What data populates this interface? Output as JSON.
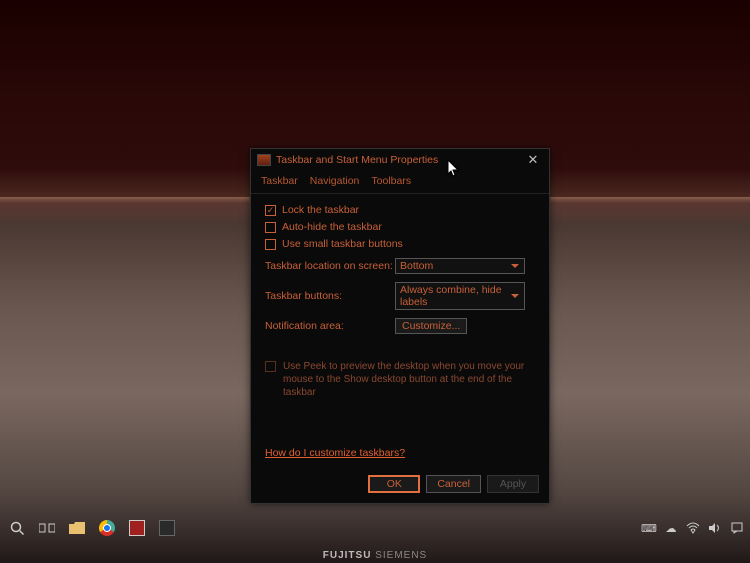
{
  "dialog": {
    "title": "Taskbar and Start Menu Properties",
    "tabs": [
      "Taskbar",
      "Navigation",
      "Toolbars"
    ],
    "checkboxes": {
      "lock": {
        "label": "Lock the taskbar",
        "checked": true
      },
      "autohide": {
        "label": "Auto-hide the taskbar",
        "checked": false
      },
      "small": {
        "label": "Use small taskbar buttons",
        "checked": false
      }
    },
    "location": {
      "label": "Taskbar location on screen:",
      "value": "Bottom"
    },
    "buttons_opt": {
      "label": "Taskbar buttons:",
      "value": "Always combine, hide labels"
    },
    "notif": {
      "label": "Notification area:",
      "button": "Customize..."
    },
    "peek": "Use Peek to preview the desktop when you move your mouse to the Show desktop button at the end of the taskbar",
    "help_link": "How do I customize taskbars?",
    "ok": "OK",
    "cancel": "Cancel",
    "apply": "Apply"
  },
  "brand": {
    "make": "FUJITSU",
    "model": "SIEMENS"
  }
}
